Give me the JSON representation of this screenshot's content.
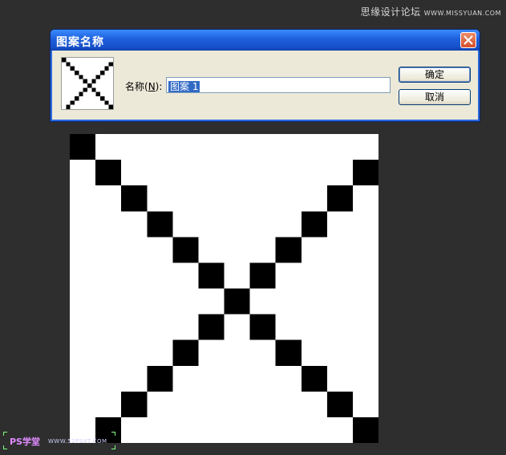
{
  "watermark_top": {
    "text": "思缘设计论坛",
    "site": "WWW.MISSYUAN.COM"
  },
  "dialog": {
    "title": "图案名称",
    "name_label_pre": "名称(",
    "name_label_key": "N",
    "name_label_post": "):",
    "name_value": "图案 1",
    "ok_label": "确定",
    "cancel_label": "取消"
  },
  "watermark_bottom": {
    "brand": "PS学堂",
    "site": "WWW.52PSXT.COM"
  },
  "pattern": {
    "grid_size": 12,
    "fill_color": "#000000",
    "background_color": "#ffffff",
    "cells": [
      [
        0,
        0
      ],
      [
        1,
        1
      ],
      [
        2,
        2
      ],
      [
        3,
        3
      ],
      [
        4,
        4
      ],
      [
        5,
        5
      ],
      [
        6,
        6
      ],
      [
        7,
        7
      ],
      [
        8,
        8
      ],
      [
        9,
        9
      ],
      [
        10,
        10
      ],
      [
        11,
        11
      ],
      [
        11,
        1
      ],
      [
        10,
        2
      ],
      [
        9,
        3
      ],
      [
        8,
        4
      ],
      [
        7,
        5
      ],
      [
        6,
        6
      ],
      [
        5,
        7
      ],
      [
        4,
        8
      ],
      [
        3,
        9
      ],
      [
        2,
        10
      ],
      [
        1,
        11
      ]
    ]
  }
}
